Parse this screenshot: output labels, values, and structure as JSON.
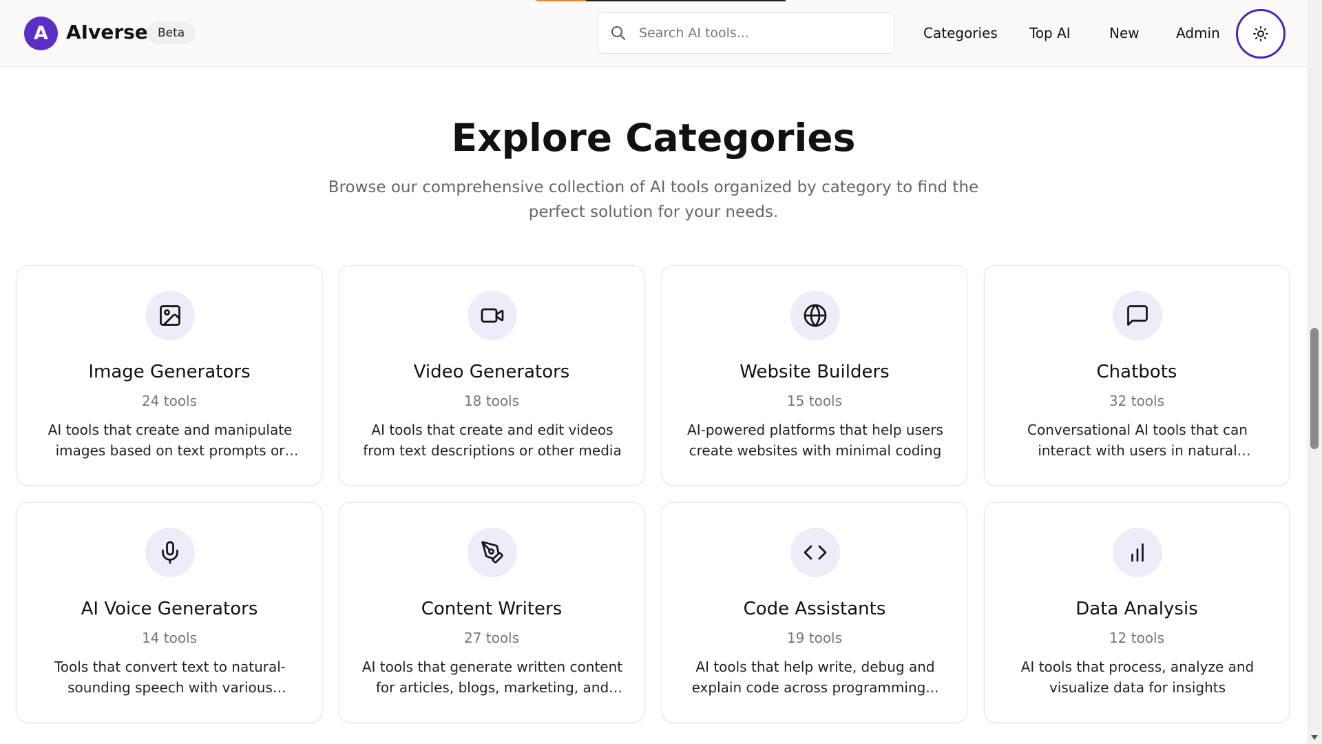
{
  "header": {
    "logo_letter": "A",
    "brand": "AIverse",
    "badge": "Beta",
    "loading_progress": 0.2,
    "search": {
      "placeholder": "Search AI tools...",
      "value": ""
    },
    "nav": [
      "Categories",
      "Top AI",
      "New",
      "Admin"
    ],
    "theme_icon": "sun-icon"
  },
  "main": {
    "title": "Explore Categories",
    "subtitle": "Browse our comprehensive collection of AI tools organized by category to find the perfect solution for your needs."
  },
  "categories": [
    {
      "icon": "image-icon",
      "title": "Image Generators",
      "count": "24 tools",
      "description": "AI tools that create and manipulate images based on text prompts or oth..."
    },
    {
      "icon": "video-icon",
      "title": "Video Generators",
      "count": "18 tools",
      "description": "AI tools that create and edit videos from text descriptions or other media"
    },
    {
      "icon": "globe-icon",
      "title": "Website Builders",
      "count": "15 tools",
      "description": "AI-powered platforms that help users create websites with minimal coding"
    },
    {
      "icon": "chat-icon",
      "title": "Chatbots",
      "count": "32 tools",
      "description": "Conversational AI tools that can interact with users in natural language"
    },
    {
      "icon": "microphone-icon",
      "title": "AI Voice Generators",
      "count": "14 tools",
      "description": "Tools that convert text to natural-sounding speech with various voices..."
    },
    {
      "icon": "pen-tool-icon",
      "title": "Content Writers",
      "count": "27 tools",
      "description": "AI tools that generate written content for articles, blogs, marketing, and more"
    },
    {
      "icon": "code-icon",
      "title": "Code Assistants",
      "count": "19 tools",
      "description": "AI tools that help write, debug and explain code across programming..."
    },
    {
      "icon": "bar-chart-icon",
      "title": "Data Analysis",
      "count": "12 tools",
      "description": "AI tools that process, analyze and visualize data for insights"
    }
  ],
  "colors": {
    "brand": "#5b2fc4",
    "icon_bg": "#efecfa",
    "progress": "#e8872e"
  }
}
